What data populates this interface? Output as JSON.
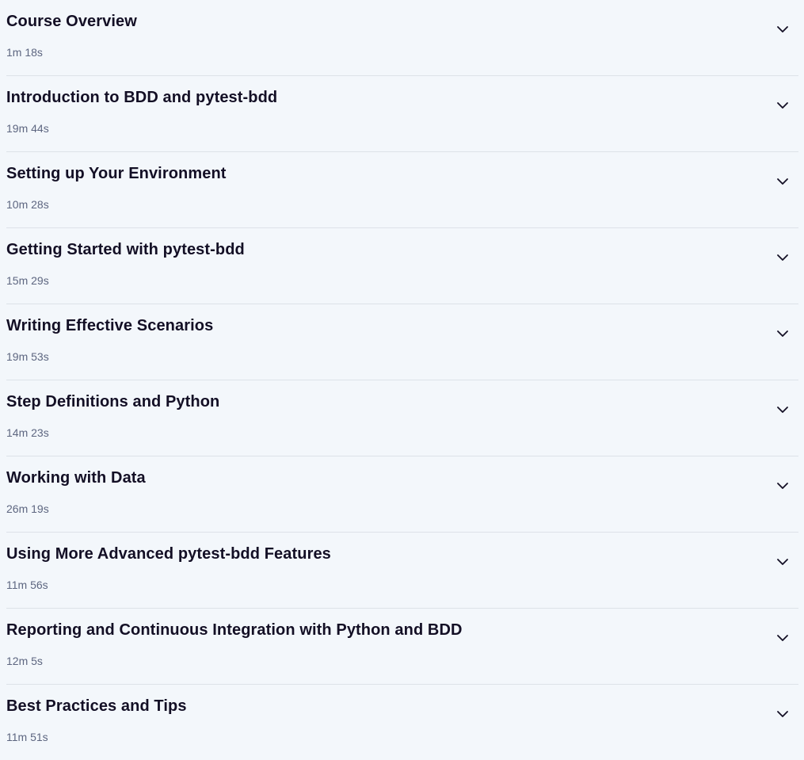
{
  "modules": [
    {
      "title": "Course Overview",
      "duration": "1m 18s"
    },
    {
      "title": "Introduction to BDD and pytest-bdd",
      "duration": "19m 44s"
    },
    {
      "title": "Setting up Your Environment",
      "duration": "10m 28s"
    },
    {
      "title": "Getting Started with pytest-bdd",
      "duration": "15m 29s"
    },
    {
      "title": "Writing Effective Scenarios",
      "duration": "19m 53s"
    },
    {
      "title": "Step Definitions and Python",
      "duration": "14m 23s"
    },
    {
      "title": "Working with Data",
      "duration": "26m 19s"
    },
    {
      "title": "Using More Advanced pytest-bdd Features",
      "duration": "11m 56s"
    },
    {
      "title": "Reporting and Continuous Integration with Python and BDD",
      "duration": "12m 5s"
    },
    {
      "title": "Best Practices and Tips",
      "duration": "11m 51s"
    }
  ],
  "icons": {
    "expand": "chevron-down-icon"
  },
  "colors": {
    "background": "#f3f7fb",
    "title": "#130f25",
    "duration": "#5d6680",
    "divider": "#dde2e8"
  }
}
